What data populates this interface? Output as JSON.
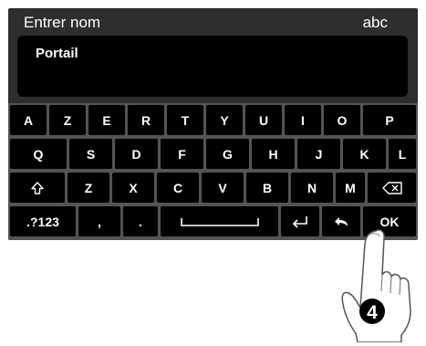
{
  "header": {
    "title": "Entrer nom",
    "mode": "abc"
  },
  "input": {
    "value": "Portail"
  },
  "keyboard": {
    "row1": [
      "A",
      "Z",
      "E",
      "R",
      "T",
      "Y",
      "U",
      "I",
      "O",
      "P"
    ],
    "row2": [
      "Q",
      "S",
      "D",
      "F",
      "G",
      "H",
      "J",
      "K",
      "L"
    ],
    "row3": [
      "Z",
      "X",
      "C",
      "V",
      "B",
      "N",
      "M"
    ],
    "shift_icon": "shift-arrow-icon",
    "backspace_icon": "backspace-icon",
    "symbols_label": ".?123",
    "comma_label": ",",
    "period_label": ".",
    "space_icon": "space-bar-icon",
    "enter_icon": "enter-arrow-icon",
    "back_icon": "back-arrow-icon",
    "ok_label": "OK"
  },
  "annotation": {
    "step_number": "4"
  }
}
